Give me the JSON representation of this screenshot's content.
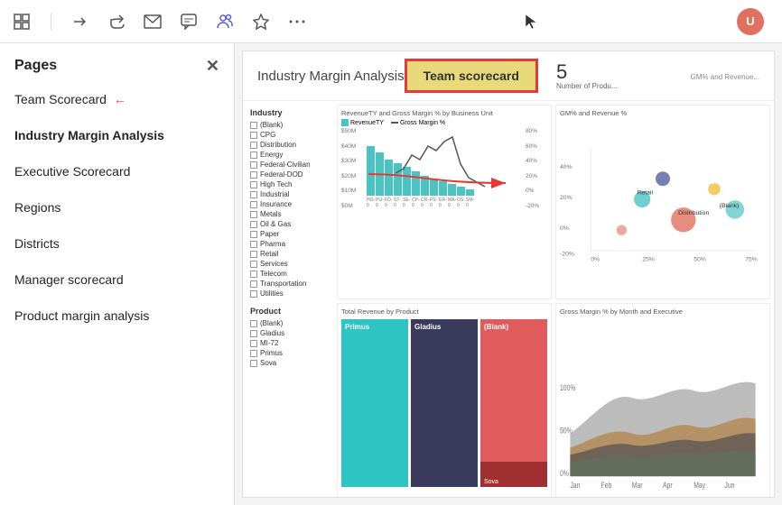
{
  "toolbar": {
    "icons": [
      "grid-icon",
      "arrow-right-icon",
      "share-icon",
      "email-icon",
      "chat-icon",
      "teams-icon",
      "star-icon",
      "more-icon"
    ]
  },
  "sidebar": {
    "title": "Pages",
    "close_label": "✕",
    "items": [
      {
        "id": "team-scorecard",
        "label": "Team Scorecard",
        "active": false,
        "bold": false,
        "arrow": true
      },
      {
        "id": "industry-margin-analysis",
        "label": "Industry Margin Analysis",
        "active": true,
        "bold": true,
        "arrow": false
      },
      {
        "id": "executive-scorecard",
        "label": "Executive Scorecard",
        "active": false,
        "bold": false,
        "arrow": false
      },
      {
        "id": "regions",
        "label": "Regions",
        "active": false,
        "bold": false,
        "arrow": false
      },
      {
        "id": "districts",
        "label": "Districts",
        "active": false,
        "bold": false,
        "arrow": false
      },
      {
        "id": "manager-scorecard",
        "label": "Manager scorecard",
        "active": false,
        "bold": false,
        "arrow": false
      },
      {
        "id": "product-margin-analysis",
        "label": "Product margin analysis",
        "active": false,
        "bold": false,
        "arrow": false
      }
    ]
  },
  "content": {
    "page_title": "Industry Margin Analysis",
    "scorecard_label": "Team scorecard",
    "number_value": "5",
    "number_label": "Number of Produ...",
    "right_label": "GM% and Revenue..."
  },
  "filters": {
    "industry_title": "Industry",
    "items": [
      "(Blank)",
      "CPG",
      "Distribution",
      "Energy",
      "Federal-Civilian",
      "Federal-DOD",
      "High Tech",
      "Industrial",
      "Insurance",
      "Metals",
      "Oil & Gas",
      "Paper",
      "Pharma",
      "Retail",
      "Services",
      "Telecom",
      "Transportation",
      "Utilities"
    ],
    "product_title": "Product",
    "product_items": [
      "(Blank)",
      "Gladius",
      "MI-72",
      "Primus",
      "Sova"
    ]
  },
  "charts": {
    "bar_title": "RevenueTY and Gross Margin % by Business Unit",
    "stacked_title": "Total Revenue by Product",
    "area_title": "Gross Margin % by Month and Executive",
    "legend": [
      "RevenueTY",
      "Gross Margin %"
    ],
    "bars": [
      55,
      48,
      42,
      38,
      35,
      30,
      28,
      25,
      20,
      18,
      15,
      12,
      10,
      8
    ],
    "stacked_cols": [
      {
        "label": "Primus",
        "color1": "#2ec4c4",
        "color2": "#1a9a9a",
        "height1": 60,
        "height2": 40
      },
      {
        "label": "Gladius",
        "color1": "#3a3a5c",
        "color2": "#555580",
        "height1": 50,
        "height2": 50
      },
      {
        "label": "(Blank)",
        "color1": "#e05c5c",
        "color2": "#c04040",
        "height1": 40,
        "height2": 60
      }
    ],
    "bar_axis_labels": [
      "HO-0",
      "PU-0",
      "FO-0",
      "ST-0",
      "SE-0",
      "CP-0",
      "CR-0",
      "FS-0",
      "ER-0",
      "MA-0",
      "OS-0",
      "SM-0"
    ],
    "y_axis_labels": [
      "$50M",
      "$40M",
      "$30M",
      "$20M",
      "$10M",
      "$0M"
    ]
  }
}
